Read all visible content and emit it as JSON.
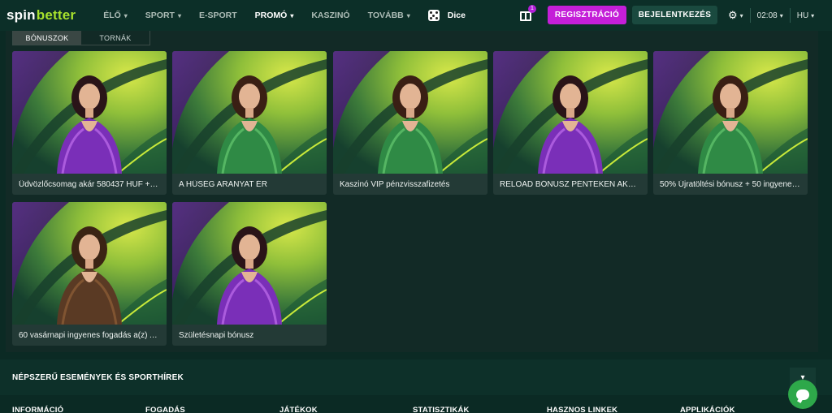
{
  "header": {
    "logo_spin": "spin",
    "logo_better": "better",
    "nav": [
      {
        "label": "ÉLŐ",
        "has_dropdown": true,
        "active": false
      },
      {
        "label": "SPORT",
        "has_dropdown": true,
        "active": false
      },
      {
        "label": "E-SPORT",
        "has_dropdown": false,
        "active": false
      },
      {
        "label": "PROMÓ",
        "has_dropdown": true,
        "active": true
      },
      {
        "label": "KASZINÓ",
        "has_dropdown": false,
        "active": false
      },
      {
        "label": "TOVÁBB",
        "has_dropdown": true,
        "active": false
      }
    ],
    "dice_label": "Dice",
    "gift_count": "1",
    "register_label": "REGISZTRÁCIÓ",
    "login_label": "BEJELENTKEZÉS",
    "time": "02:08",
    "language": "HU",
    "chevron_glyph": "▾",
    "gear_glyph": "⚙"
  },
  "tabs": [
    {
      "label": "BÓNUSZOK",
      "active": true
    },
    {
      "label": "TORNÁK",
      "active": false
    }
  ],
  "promos": [
    {
      "title": "Üdvözlőcsomag akár 580437 HUF + 1...",
      "theme": "purple",
      "accent": "#7a2fb8"
    },
    {
      "title": "A HŰSÉG ARANYAT ÉR",
      "theme": "green",
      "accent": "#2f8a45"
    },
    {
      "title": "Kaszinó VIP pénzvisszafizetés",
      "theme": "green",
      "accent": "#2f8a45"
    },
    {
      "title": "RELOAD BÓNUSZ PÉNTEKEN AKÁR 2...",
      "theme": "purple",
      "accent": "#7a2fb8"
    },
    {
      "title": "50% Újratöltési bónusz + 50 ingyenes ...",
      "theme": "green",
      "accent": "#2f8a45"
    },
    {
      "title": "60 vasárnapi ingyenes fogadás a(z) A...",
      "theme": "brown",
      "accent": "#5a3a24"
    },
    {
      "title": "Születésnapi bónusz",
      "theme": "purple",
      "accent": "#7a2fb8"
    }
  ],
  "popular_section": {
    "title": "NÉPSZERŰ ESEMÉNYEK ÉS SPORTHÍREK"
  },
  "footer_columns": [
    "INFORMÁCIÓ",
    "FOGADÁS",
    "JÁTÉKOK",
    "STATISZTIKÁK",
    "HASZNOS LINKEK",
    "APPLIKÁCIÓK"
  ],
  "colors": {
    "brand_green": "#a8e22d",
    "register_magenta": "#c41fd8",
    "chat_green": "#2ea84a"
  }
}
